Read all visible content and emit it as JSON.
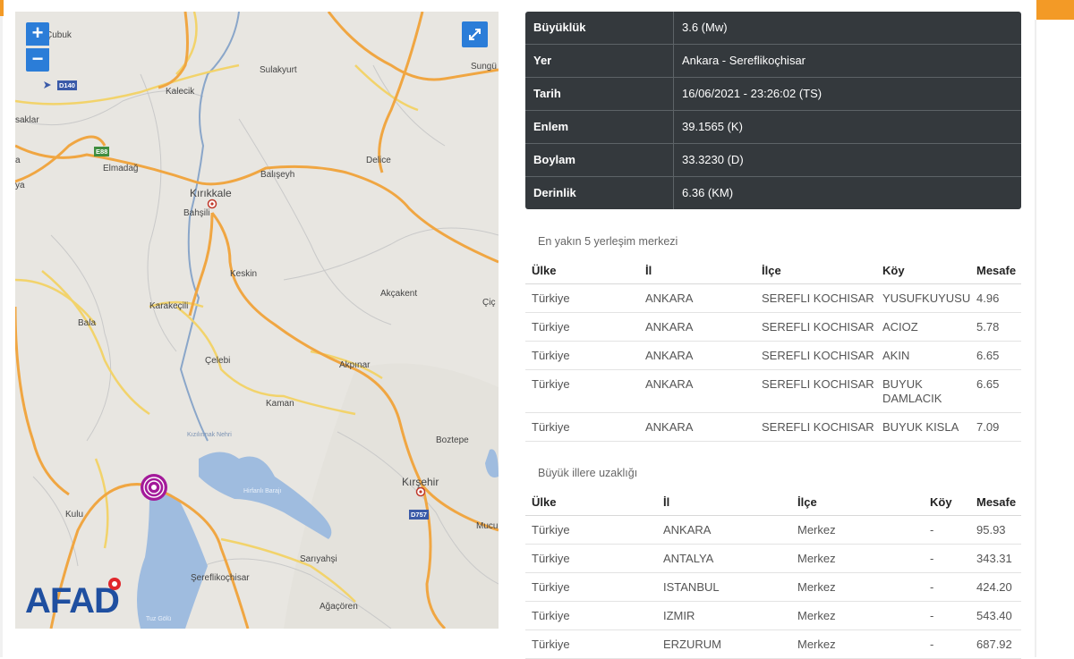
{
  "map": {
    "zoom_in": "+",
    "zoom_out": "−",
    "logo": "AFAD",
    "labels": {
      "cubuk": "Çubuk",
      "sulakyurt": "Sulakyurt",
      "sungurlu": "Sungü",
      "kalecik": "Kalecik",
      "saklar": "saklar",
      "elmadag": "Elmadağ",
      "baliseyh": "Balışeyh",
      "delice": "Delice",
      "kirikkale": "Kırıkkale",
      "bahsili": "Bahşili",
      "keskin": "Keskin",
      "akcakent": "Akçakent",
      "cic": "Çiç",
      "karakecili": "Karakeçili",
      "bala": "Bala",
      "celebi": "Çelebi",
      "akpinar": "Akpınar",
      "kaman": "Kaman",
      "boztepe": "Boztepe",
      "kizilirmak": "Kızılırmak Nehri",
      "kirsehir": "Kırşehir",
      "hirfanli": "Hirfanlı Barajı",
      "mucur": "Mucu",
      "kulu": "Kulu",
      "sariyahsi": "Sarıyahşi",
      "sereflikochisar": "Şereflikoçhisar",
      "agacoren": "Ağaçören",
      "a_edge": "a",
      "ya_edge": "ya",
      "tuz_golu": "Tuz Gölü"
    },
    "shields": {
      "d140": "D140",
      "e88": "E88",
      "d757": "D757"
    }
  },
  "info": [
    {
      "key": "Büyüklük",
      "value": "3.6 (Mw)"
    },
    {
      "key": "Yer",
      "value": "Ankara - Sereflikoçhisar"
    },
    {
      "key": "Tarih",
      "value": "16/06/2021 - 23:26:02 (TS)"
    },
    {
      "key": "Enlem",
      "value": "39.1565 (K)"
    },
    {
      "key": "Boylam",
      "value": "33.3230 (D)"
    },
    {
      "key": "Derinlik",
      "value": "6.36 (KM)"
    }
  ],
  "nearest": {
    "title": "En yakın 5 yerleşim merkezi",
    "headers": [
      "Ülke",
      "İl",
      "İlçe",
      "Köy",
      "Mesafe"
    ],
    "rows": [
      [
        "Türkiye",
        "ANKARA",
        "SEREFLI KOCHISAR",
        "YUSUFKUYUSU",
        "4.96"
      ],
      [
        "Türkiye",
        "ANKARA",
        "SEREFLI KOCHISAR",
        "ACIOZ",
        "5.78"
      ],
      [
        "Türkiye",
        "ANKARA",
        "SEREFLI KOCHISAR",
        "AKIN",
        "6.65"
      ],
      [
        "Türkiye",
        "ANKARA",
        "SEREFLI KOCHISAR",
        "BUYUK DAMLACIK",
        "6.65"
      ],
      [
        "Türkiye",
        "ANKARA",
        "SEREFLI KOCHISAR",
        "BUYUK KISLA",
        "7.09"
      ]
    ]
  },
  "cities": {
    "title": "Büyük illere uzaklığı",
    "headers": [
      "Ülke",
      "İl",
      "İlçe",
      "Köy",
      "Mesafe"
    ],
    "rows": [
      [
        "Türkiye",
        "ANKARA",
        "Merkez",
        "-",
        "95.93"
      ],
      [
        "Türkiye",
        "ANTALYA",
        "Merkez",
        "-",
        "343.31"
      ],
      [
        "Türkiye",
        "ISTANBUL",
        "Merkez",
        "-",
        "424.20"
      ],
      [
        "Türkiye",
        "IZMIR",
        "Merkez",
        "-",
        "543.40"
      ],
      [
        "Türkiye",
        "ERZURUM",
        "Merkez",
        "-",
        "687.92"
      ]
    ]
  }
}
